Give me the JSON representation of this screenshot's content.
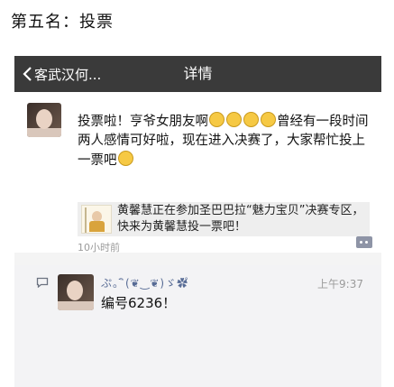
{
  "caption": "第五名：投票",
  "navbar": {
    "back_label": "客武汉何...",
    "title": "详情"
  },
  "post": {
    "text_part1": "投票啦！亨爷女朋友啊",
    "text_part2": "曾经有一段时间两人感情可好啦，现在进入决赛了，大家帮忙投上一票吧",
    "emoji_icon": "grinning-emoji-icon",
    "share_text": "黄馨慧正在参加圣巴巴拉“魅力宝贝”决赛专区，快来为黄馨慧投一票吧！",
    "time": "10小时前"
  },
  "comment": {
    "name": "ぷ。ิ(❦‿❦)ゞ✿゚",
    "time": "上午9:37",
    "text": "编号6236！"
  },
  "colors": {
    "navbar_bg": "#3a3a3a",
    "link_blue": "#576b95",
    "comment_bg": "#f3f3f5"
  }
}
